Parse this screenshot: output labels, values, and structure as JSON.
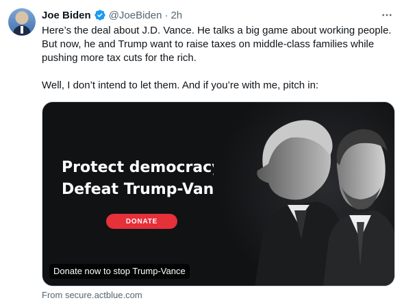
{
  "author": {
    "name": "Joe Biden",
    "handle": "@JoeBiden",
    "separator": "·",
    "time": "2h",
    "verified_color": "#1d9bf0"
  },
  "more_icon": "more-horizontal-icon",
  "tweet_text": {
    "paragraph_1": "Here’s the deal about J.D. Vance. He talks a big game about working people. But now, he and Trump want to raise taxes on middle-class families while pushing more tax cuts for the rich.",
    "paragraph_2": "Well, I don’t intend to let them. And if you’re with me, pitch in:"
  },
  "card": {
    "headline_line_1": "Protect democracy.",
    "headline_line_2": "Defeat Trump-Vance.",
    "button_label": "DONATE",
    "button_color": "#e6303a",
    "caption": "Donate now to stop Trump-Vance",
    "background": "#111214"
  },
  "source_link": "From secure.actblue.com"
}
